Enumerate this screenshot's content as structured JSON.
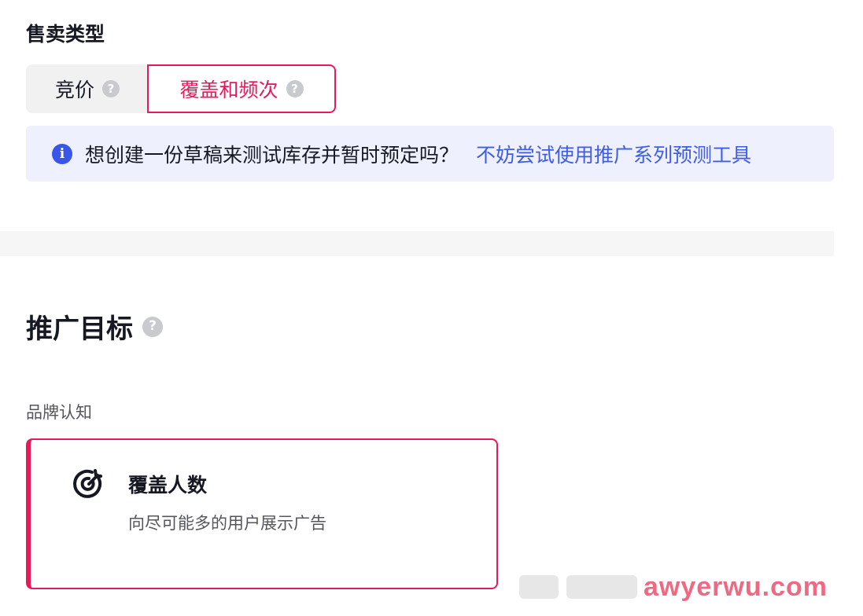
{
  "sale_type": {
    "title": "售卖类型",
    "options": [
      {
        "label": "竞价",
        "selected": false
      },
      {
        "label": "覆盖和频次",
        "selected": true
      }
    ]
  },
  "banner": {
    "icon": "info-icon",
    "message": "想创建一份草稿来测试库存并暂时预定吗？",
    "link": "不妨尝试使用推广系列预测工具"
  },
  "objective": {
    "title": "推广目标",
    "category": "品牌认知",
    "card": {
      "icon": "target-icon",
      "title": "覆盖人数",
      "description": "向尽可能多的用户展示广告"
    }
  },
  "watermark": "awyerwu.com",
  "colors": {
    "accent": "#e8195b",
    "link": "#3f5ce6",
    "banner_bg": "#eef1fd",
    "info_icon": "#3a56e8"
  }
}
